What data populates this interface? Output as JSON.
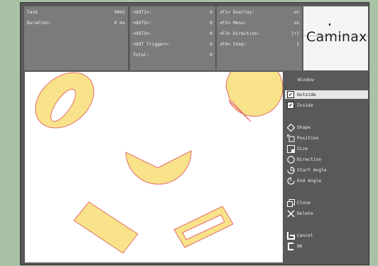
{
  "status": {
    "col1": [
      {
        "key": "Task",
        "value": "0002"
      },
      {
        "key": "Duration:",
        "value": "0 ms"
      }
    ],
    "col2": [
      {
        "key": "<OUT1>:",
        "value": "0"
      },
      {
        "key": "<OUT2>:",
        "value": "0"
      },
      {
        "key": "<OUT3>:",
        "value": "0"
      },
      {
        "key": "<OUT Trigger>:",
        "value": "0"
      },
      {
        "key": "Total:",
        "value": "0"
      }
    ],
    "col3": [
      {
        "key": "<F1> Overlay:",
        "value": "on"
      },
      {
        "key": "<F2> Menu:",
        "value": "on"
      },
      {
        "key": "<F3> Direction:",
        "value": "[+]"
      },
      {
        "key": "<F4> Step:",
        "value": "1"
      }
    ]
  },
  "brand": {
    "name": "Caminax"
  },
  "sidebar": {
    "title": "Window",
    "outside": {
      "label": "Outside",
      "checked": "✔"
    },
    "inside": {
      "label": "Inside",
      "checked": "✔"
    },
    "shape": "Shape",
    "position": "Position",
    "size": "Size",
    "direction": "Direction",
    "start_angle": "Start Angle",
    "end_angle": "End Angle",
    "clone": "Clone",
    "delete": "Delete",
    "cancel": "Cancel",
    "ok": "OK"
  },
  "colors": {
    "shape_fill": "#f8e38a",
    "shape_stroke": "#e46a6a",
    "selected_bg": "#e6e6e6"
  }
}
